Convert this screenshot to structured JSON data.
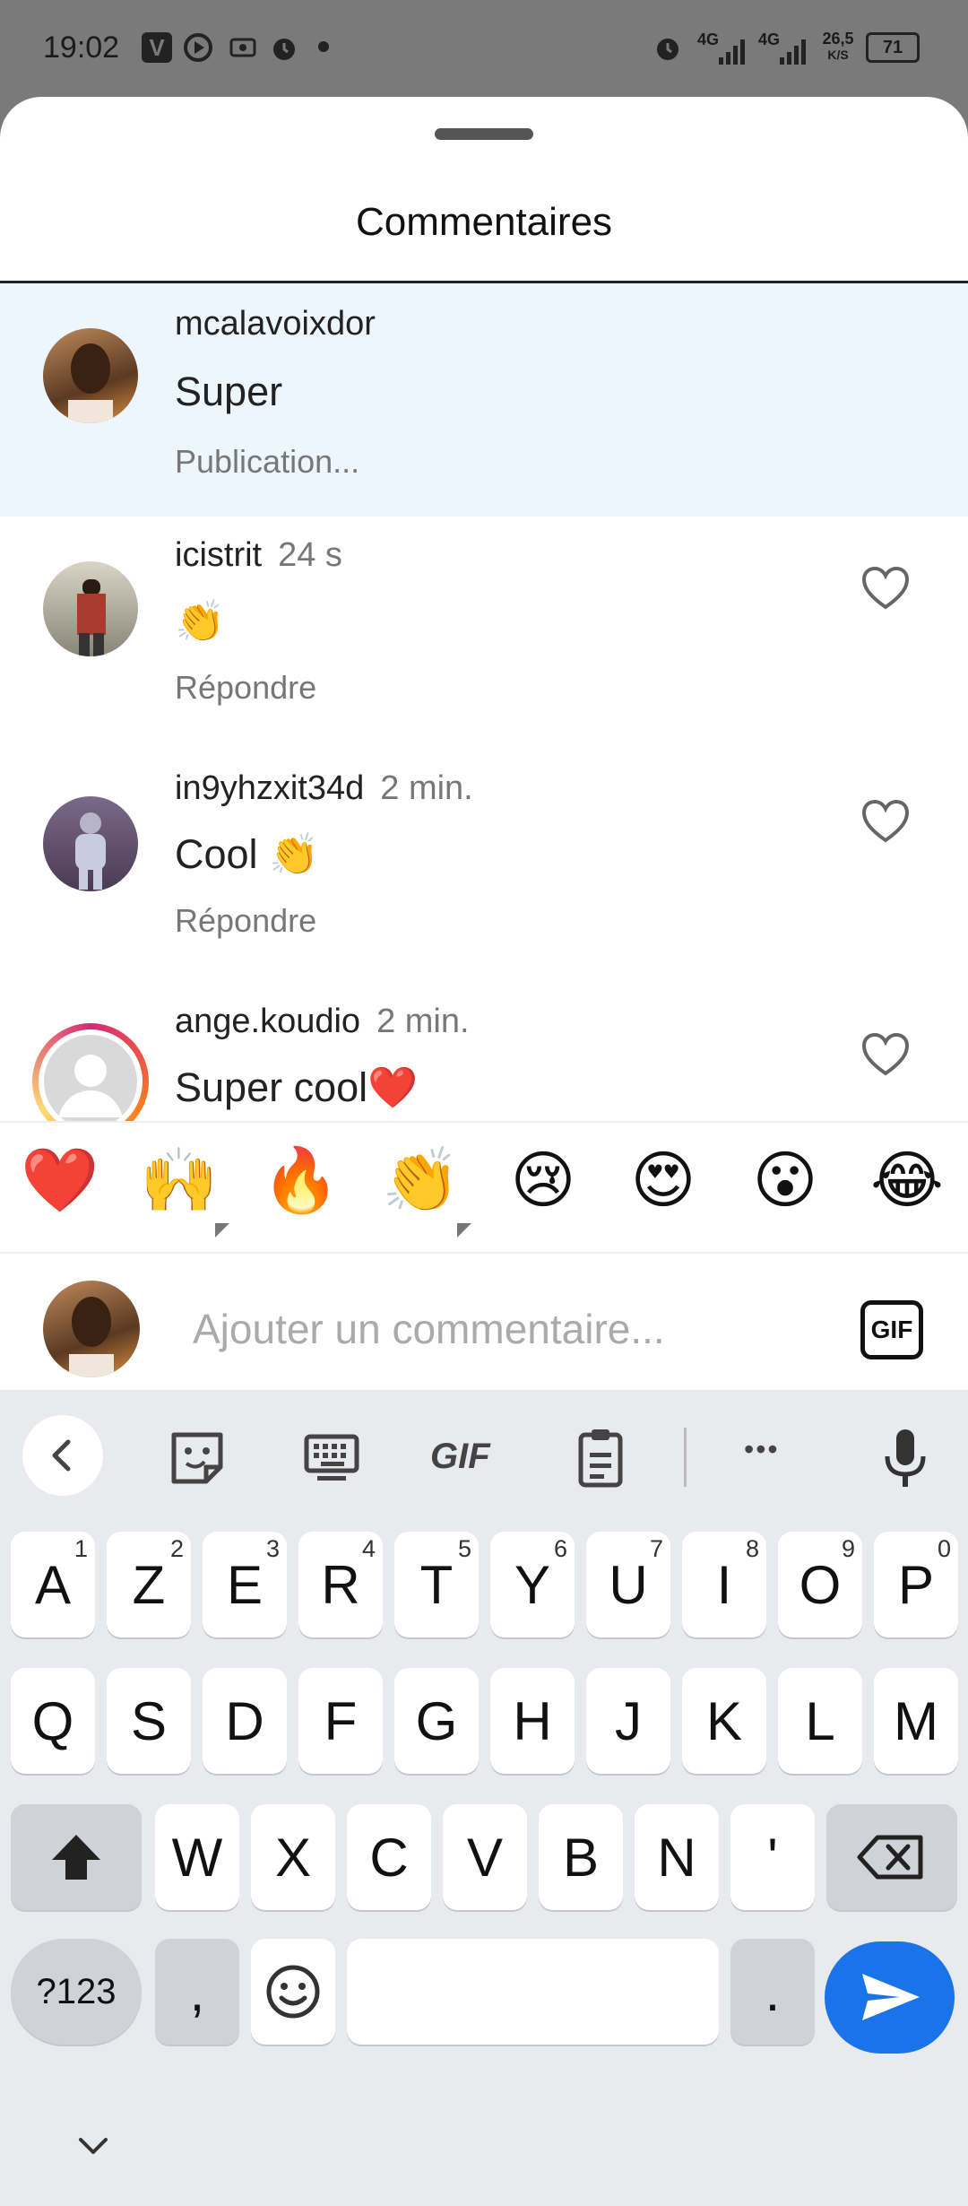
{
  "status_bar": {
    "time": "19:02",
    "network_a": "4G",
    "network_b": "4G",
    "speed": "26,5",
    "speed_unit": "K/S",
    "battery": "71"
  },
  "sheet": {
    "title": "Commentaires"
  },
  "comments": [
    {
      "user": "mcalavoixdor",
      "time": "",
      "text": "Super",
      "meta": "Publication...",
      "highlight": true
    },
    {
      "user": "icistrit",
      "time": "24 s",
      "text": "👏",
      "meta": "Répondre",
      "highlight": false
    },
    {
      "user": "in9yhzxit34d",
      "time": "2 min.",
      "text": "Cool 👏",
      "meta": "Répondre",
      "highlight": false
    },
    {
      "user": "ange.koudio",
      "time": "2 min.",
      "text": "Super cool❤️",
      "meta": "",
      "highlight": false
    }
  ],
  "emoji_bar": [
    "❤️",
    "🙌",
    "🔥",
    "👏",
    "😢",
    "😍",
    "😮",
    "😂"
  ],
  "composer": {
    "placeholder": "Ajouter un commentaire...",
    "gif_label": "GIF"
  },
  "keyboard": {
    "toolbar": {
      "gif": "GIF",
      "more": "•••"
    },
    "row1": [
      [
        "A",
        "1"
      ],
      [
        "Z",
        "2"
      ],
      [
        "E",
        "3"
      ],
      [
        "R",
        "4"
      ],
      [
        "T",
        "5"
      ],
      [
        "Y",
        "6"
      ],
      [
        "U",
        "7"
      ],
      [
        "I",
        "8"
      ],
      [
        "O",
        "9"
      ],
      [
        "P",
        "0"
      ]
    ],
    "row2": [
      "Q",
      "S",
      "D",
      "F",
      "G",
      "H",
      "J",
      "K",
      "L",
      "M"
    ],
    "row3": [
      "W",
      "X",
      "C",
      "V",
      "B",
      "N",
      "'"
    ],
    "row4": {
      "symbols": "?123",
      "comma": ",",
      "period": "."
    }
  },
  "colors": {
    "accent_blue": "#1a73e8",
    "highlight_bg": "#eef6fd"
  }
}
